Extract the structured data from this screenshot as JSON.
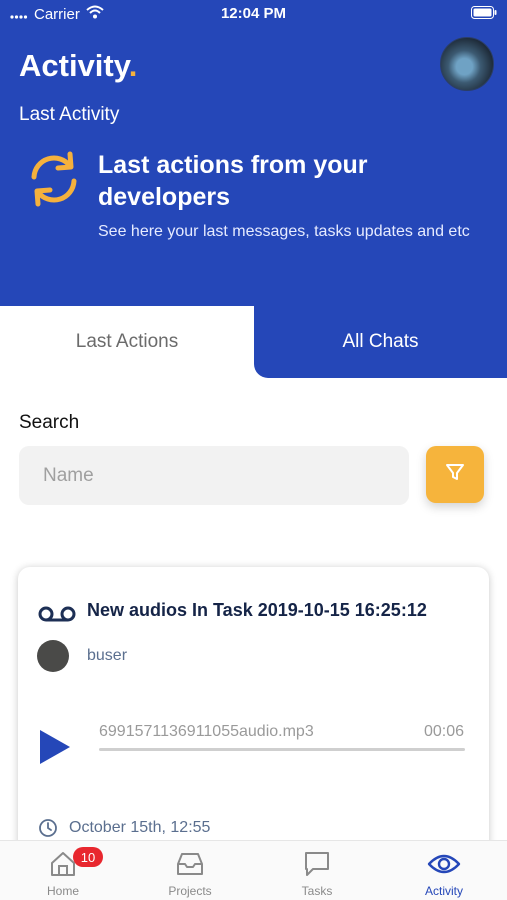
{
  "status_bar": {
    "carrier": "Carrier",
    "time": "12:04 PM"
  },
  "header": {
    "title": "Activity",
    "title_dot": ".",
    "section_label": "Last Activity",
    "promo_title": "Last actions from your developers",
    "promo_subtitle": "See here your last messages, tasks updates and etc"
  },
  "tabs": [
    {
      "label": "Last Actions",
      "active": true
    },
    {
      "label": "All Chats",
      "active": false
    }
  ],
  "search": {
    "label": "Search",
    "placeholder": "Name",
    "value": ""
  },
  "activity_card": {
    "icon": "voicemail-icon",
    "title": "New audios In Task 2019-10-15 16:25:12",
    "user": "buser",
    "audio_file": "6991571136911055audio.mp3",
    "duration": "00:06",
    "progress": 0,
    "date": "October 15th, 12:55"
  },
  "tab_bar": {
    "items": [
      {
        "label": "Home",
        "icon": "home-icon",
        "badge": "10"
      },
      {
        "label": "Projects",
        "icon": "inbox-icon"
      },
      {
        "label": "Tasks",
        "icon": "chat-icon"
      },
      {
        "label": "Activity",
        "icon": "eye-icon",
        "active": true
      }
    ]
  },
  "colors": {
    "primary": "#2547b8",
    "accent": "#f6b43c",
    "badge": "#e8272e"
  }
}
